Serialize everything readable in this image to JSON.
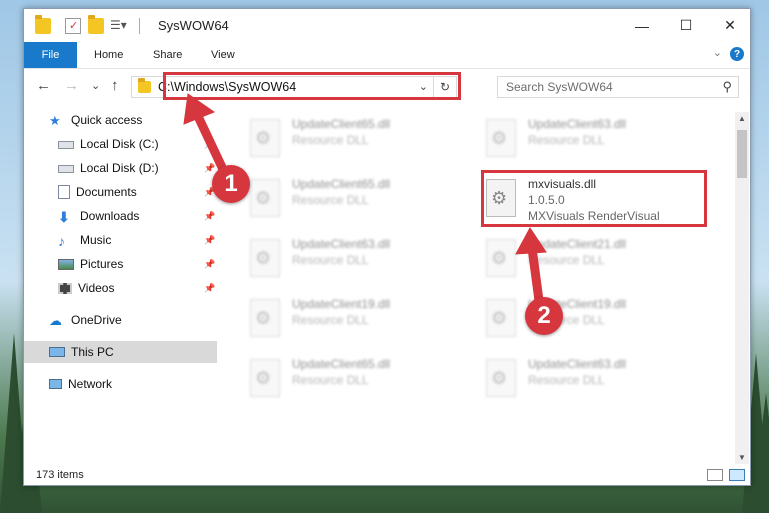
{
  "window": {
    "title": "SysWOW64",
    "controls": {
      "minimize": "—",
      "maximize": "☐",
      "close": "✕"
    }
  },
  "ribbon": {
    "file_tab": "File",
    "tabs": [
      "Home",
      "Share",
      "View"
    ],
    "help": "?"
  },
  "navigation": {
    "back": "←",
    "forward": "→",
    "recent": "⌄",
    "up": "↑",
    "address": "C:\\Windows\\SysWOW64",
    "search_placeholder": "Search SysWOW64"
  },
  "sidebar": {
    "quick_access": "Quick access",
    "items": [
      "Local Disk (C:)",
      "Local Disk (D:)",
      "Documents",
      "Downloads",
      "Music",
      "Pictures",
      "Videos"
    ],
    "onedrive": "OneDrive",
    "this_pc": "This PC",
    "network": "Network"
  },
  "files": [
    {
      "name": "UpdateClient65.dll",
      "type": "Resource DLL"
    },
    {
      "name": "UpdateClient63.dll",
      "type": "Resource DLL"
    },
    {
      "name": "UpdateClient65.dll",
      "type": "Resource DLL"
    },
    {
      "name": "UpdateClient63.dll",
      "type": "Resource DLL"
    },
    {
      "name": "UpdateClient21.dll",
      "type": "Resource DLL"
    },
    {
      "name": "UpdateClient19.dll",
      "type": "Resource DLL"
    },
    {
      "name": "UpdateClient19.dll",
      "type": "Resource DLL"
    },
    {
      "name": "UpdateClient65.dll",
      "type": "Resource DLL"
    },
    {
      "name": "UpdateClient63.dll",
      "type": "Resource DLL"
    }
  ],
  "highlighted_file": {
    "name": "mxvisuals.dll",
    "version": "1.0.5.0",
    "description": "MXVisuals RenderVisual"
  },
  "status": {
    "item_count": "173 items"
  },
  "annotations": {
    "step1": "1",
    "step2": "2",
    "color": "#d6363d"
  }
}
